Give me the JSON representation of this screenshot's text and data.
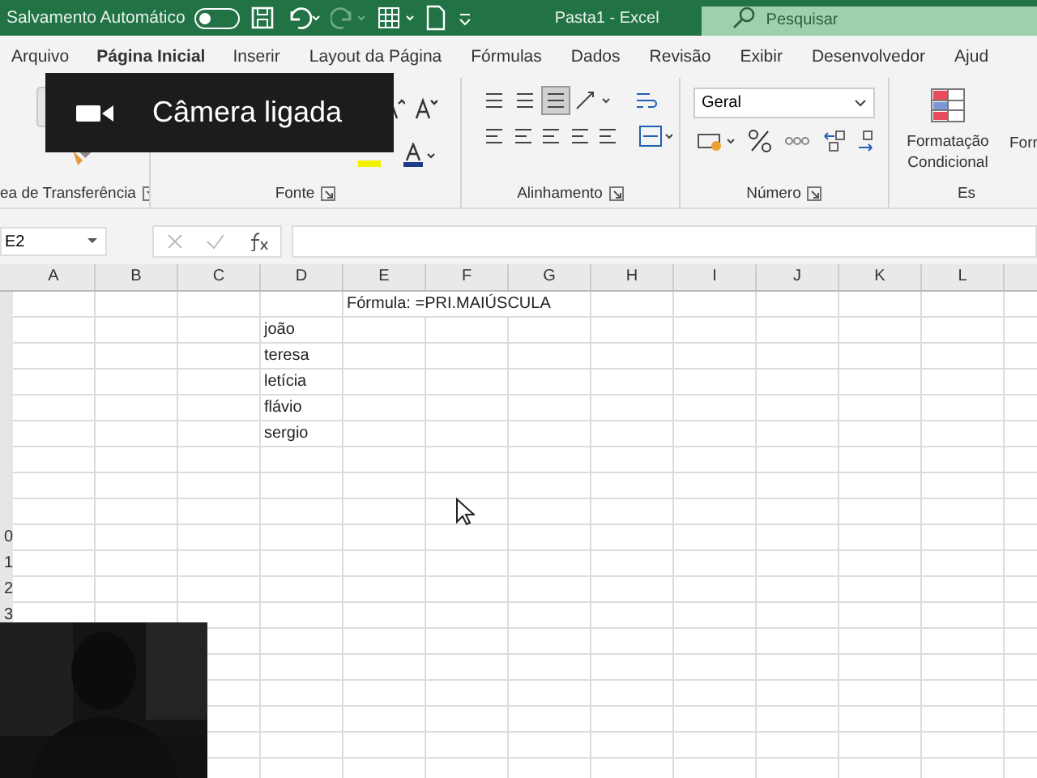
{
  "title_bar": {
    "autosave_label": "Salvamento Automático",
    "autosave_on": false,
    "document_title": "Pasta1  -  Excel",
    "search_placeholder": "Pesquisar"
  },
  "tabs": [
    {
      "label": "Arquivo",
      "selected": false
    },
    {
      "label": "Página Inicial",
      "selected": true
    },
    {
      "label": "Inserir",
      "selected": false
    },
    {
      "label": "Layout da Página",
      "selected": false
    },
    {
      "label": "Fórmulas",
      "selected": false
    },
    {
      "label": "Dados",
      "selected": false
    },
    {
      "label": "Revisão",
      "selected": false
    },
    {
      "label": "Exibir",
      "selected": false
    },
    {
      "label": "Desenvolvedor",
      "selected": false
    },
    {
      "label": "Ajud",
      "selected": false
    }
  ],
  "ribbon": {
    "groups": [
      {
        "label": "ea de Transferência"
      },
      {
        "label": "Fonte"
      },
      {
        "label": "Alinhamento"
      },
      {
        "label": "Número"
      },
      {
        "label": "Es"
      }
    ],
    "number_format": "Geral",
    "conditional_formatting": "Formatação Condicional",
    "format_as_table": "Forr"
  },
  "camera_notice": "Câmera ligada",
  "formula_bar": {
    "name_box": "E2"
  },
  "columns": [
    "A",
    "B",
    "C",
    "D",
    "E",
    "F",
    "G",
    "H",
    "I",
    "J",
    "K",
    "L"
  ],
  "rows": [
    {
      "cells": {
        "E": "Fórmula: =PRI.MAIÚSCULA"
      }
    },
    {
      "cells": {
        "D": "joão"
      }
    },
    {
      "cells": {
        "D": "teresa"
      }
    },
    {
      "cells": {
        "D": "letícia"
      }
    },
    {
      "cells": {
        "D": "flávio"
      }
    },
    {
      "cells": {
        "D": "sergio"
      }
    },
    {},
    {},
    {},
    {
      "header": "0"
    },
    {
      "header": "1"
    },
    {
      "header": "2"
    },
    {
      "header": "3"
    },
    {},
    {},
    {},
    {},
    {},
    {}
  ]
}
